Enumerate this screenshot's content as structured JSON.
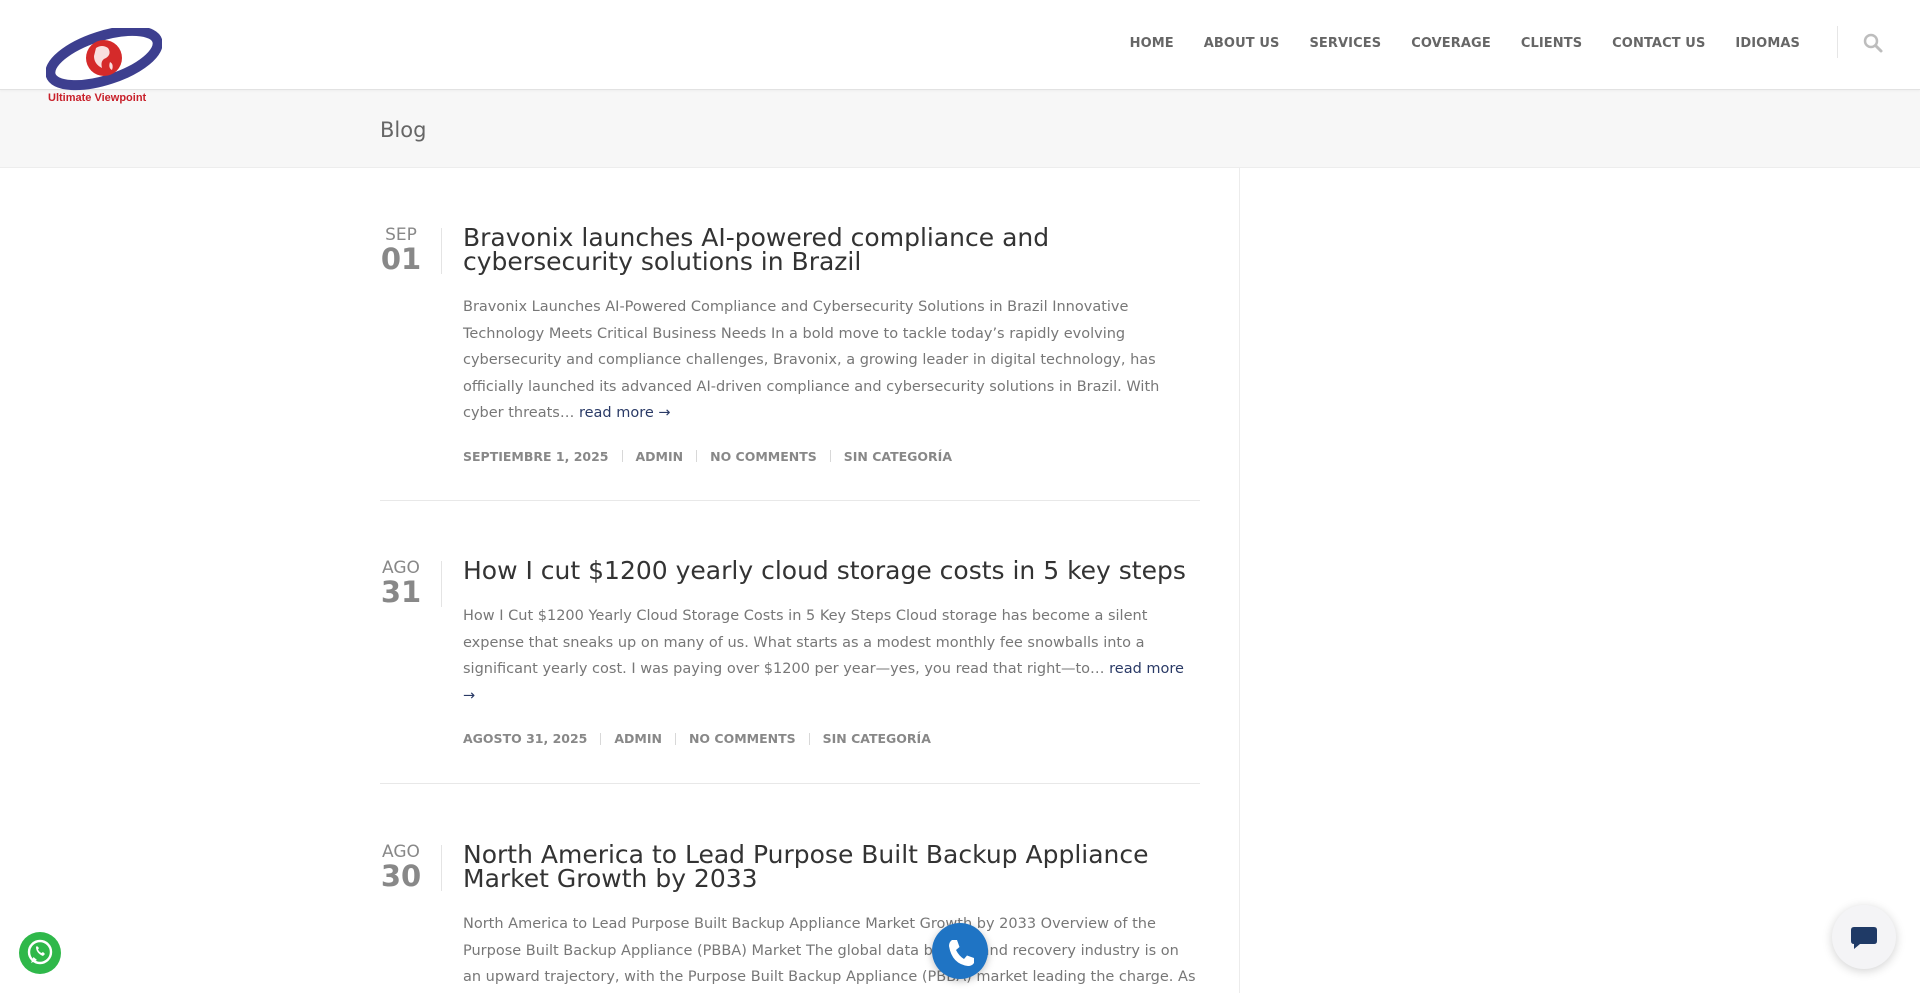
{
  "site": {
    "logo_text": "Ultimate Viewpoint"
  },
  "nav": {
    "items": [
      {
        "label": "HOME"
      },
      {
        "label": "ABOUT US"
      },
      {
        "label": "SERVICES"
      },
      {
        "label": "COVERAGE"
      },
      {
        "label": "CLIENTS"
      },
      {
        "label": "CONTACT US"
      },
      {
        "label": "IDIOMAS"
      }
    ],
    "search_icon": "search-icon"
  },
  "page": {
    "title": "Blog"
  },
  "posts": [
    {
      "month": "SEP",
      "day": "01",
      "title": "Bravonix launches AI-powered compliance and cybersecurity solutions in Brazil",
      "excerpt": "Bravonix Launches AI-Powered Compliance and Cybersecurity Solutions in Brazil Innovative Technology Meets Critical Business Needs In a bold move to tackle today’s rapidly evolving cybersecurity and compliance challenges, Bravonix, a growing leader in digital technology, has officially launched its advanced AI-driven compliance and cybersecurity solutions in Brazil. With cyber threats…",
      "read_more": "read more →",
      "date": "SEPTIEMBRE 1, 2025",
      "author": "ADMIN",
      "comments": "NO COMMENTS",
      "category": "SIN CATEGORÍA"
    },
    {
      "month": "AGO",
      "day": "31",
      "title": "How I cut $1200 yearly cloud storage costs in 5 key steps",
      "excerpt": "How I Cut $1200 Yearly Cloud Storage Costs in 5 Key Steps Cloud storage has become a silent expense that sneaks up on many of us. What starts as a modest monthly fee snowballs into a significant yearly cost. I was paying over $1200 per year—yes, you read that right—to…",
      "read_more": "read more →",
      "date": "AGOSTO 31, 2025",
      "author": "ADMIN",
      "comments": "NO COMMENTS",
      "category": "SIN CATEGORÍA"
    },
    {
      "month": "AGO",
      "day": "30",
      "title": "North America to Lead Purpose Built Backup Appliance Market Growth by 2033",
      "excerpt": "North America to Lead Purpose Built Backup Appliance Market Growth by 2033 Overview of the Purpose Built Backup Appliance (PBBA) Market The global data backup and recovery industry is on an upward trajectory, with the Purpose Built Backup Appliance (PBBA) market leading the charge. As digital transformation accelerates"
    }
  ],
  "floating": {
    "whatsapp_icon": "whatsapp-icon",
    "call_icon": "phone-icon",
    "chat_icon": "chat-icon"
  },
  "colors": {
    "accent": "#2a3a66",
    "logo_red": "#c8202a",
    "logo_purple": "#3d3f8f",
    "whatsapp": "#2fb84a",
    "call": "#1f74c4"
  }
}
